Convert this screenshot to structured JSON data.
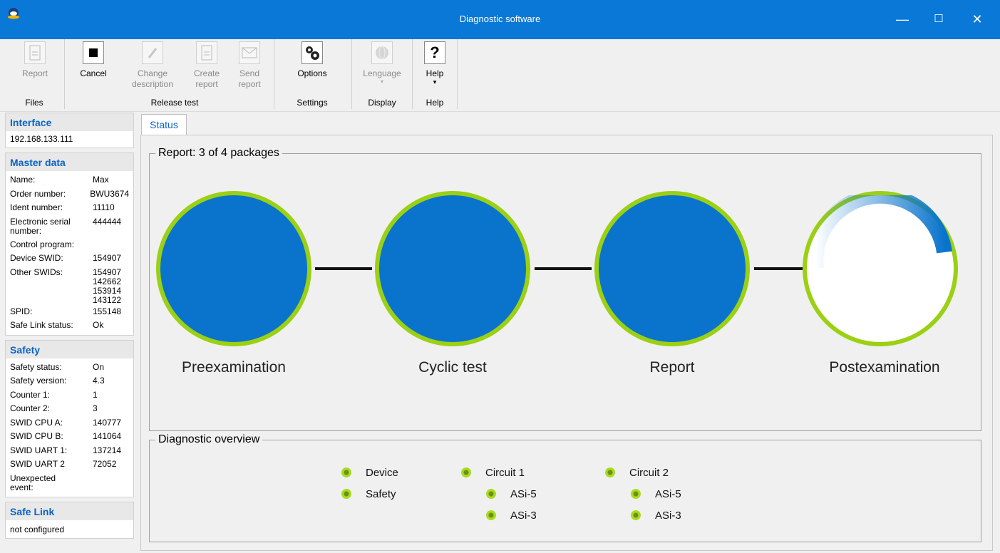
{
  "window": {
    "title": "Diagnostic software",
    "minimize": "—",
    "maximize": "☐",
    "close": "✕"
  },
  "ribbon": {
    "report": "Report",
    "cancel": "Cancel",
    "change_description": "Change description",
    "create_report": "Create report",
    "send_report": "Send report",
    "options": "Options",
    "language": "Lenguage",
    "help": "Help",
    "groups": {
      "files": "Files",
      "release_test": "Release test",
      "settings": "Settings",
      "display": "Display",
      "help": "Help"
    }
  },
  "interface": {
    "title": "Interface",
    "address": "192.168.133.111"
  },
  "master_data": {
    "title": "Master data",
    "rows": [
      {
        "key": "Name:",
        "value": "Max"
      },
      {
        "key": "Order number:",
        "value": "BWU3674"
      },
      {
        "key": "Ident number:",
        "value": "11110"
      },
      {
        "key": "Electronic serial number:",
        "value": "444444"
      },
      {
        "key": "Control program:",
        "value": ""
      },
      {
        "key": "Device SWID:",
        "value": "154907"
      },
      {
        "key": "Other SWIDs:",
        "value": [
          "154907",
          "142662",
          "153914",
          "143122"
        ]
      },
      {
        "key": "SPID:",
        "value": "155148"
      },
      {
        "key": "Safe Link status:",
        "value": "Ok"
      }
    ]
  },
  "safety": {
    "title": "Safety",
    "rows": [
      {
        "key": "Safety status:",
        "value": "On"
      },
      {
        "key": "Safety version:",
        "value": "4.3"
      },
      {
        "key": "Counter 1:",
        "value": "1"
      },
      {
        "key": "Counter 2:",
        "value": "3"
      },
      {
        "key": "SWID CPU A:",
        "value": "140777"
      },
      {
        "key": "SWID CPU B:",
        "value": "141064"
      },
      {
        "key": "SWID UART 1:",
        "value": "137214"
      },
      {
        "key": "SWID UART 2",
        "value": "72052"
      },
      {
        "key": "Unexpected event:",
        "value": ""
      }
    ]
  },
  "safe_link": {
    "title": "Safe Link",
    "status": "not configured"
  },
  "tabs": {
    "status": "Status"
  },
  "report": {
    "legend": "Report: 3 of 4 packages",
    "stages": [
      "Preexamination",
      "Cyclic test",
      "Report",
      "Postexamination"
    ],
    "completed": 3,
    "total": 4
  },
  "diagnostic": {
    "legend": "Diagnostic overview",
    "device": "Device",
    "safety": "Safety",
    "circuit1": "Circuit 1",
    "circuit2": "Circuit 2",
    "asi5": "ASi-5",
    "asi3": "ASi-3"
  },
  "colors": {
    "accent": "#0a78d7",
    "stage_fill": "#0a74cc",
    "ring": "#9bd013",
    "link_text": "#0a63c4"
  }
}
